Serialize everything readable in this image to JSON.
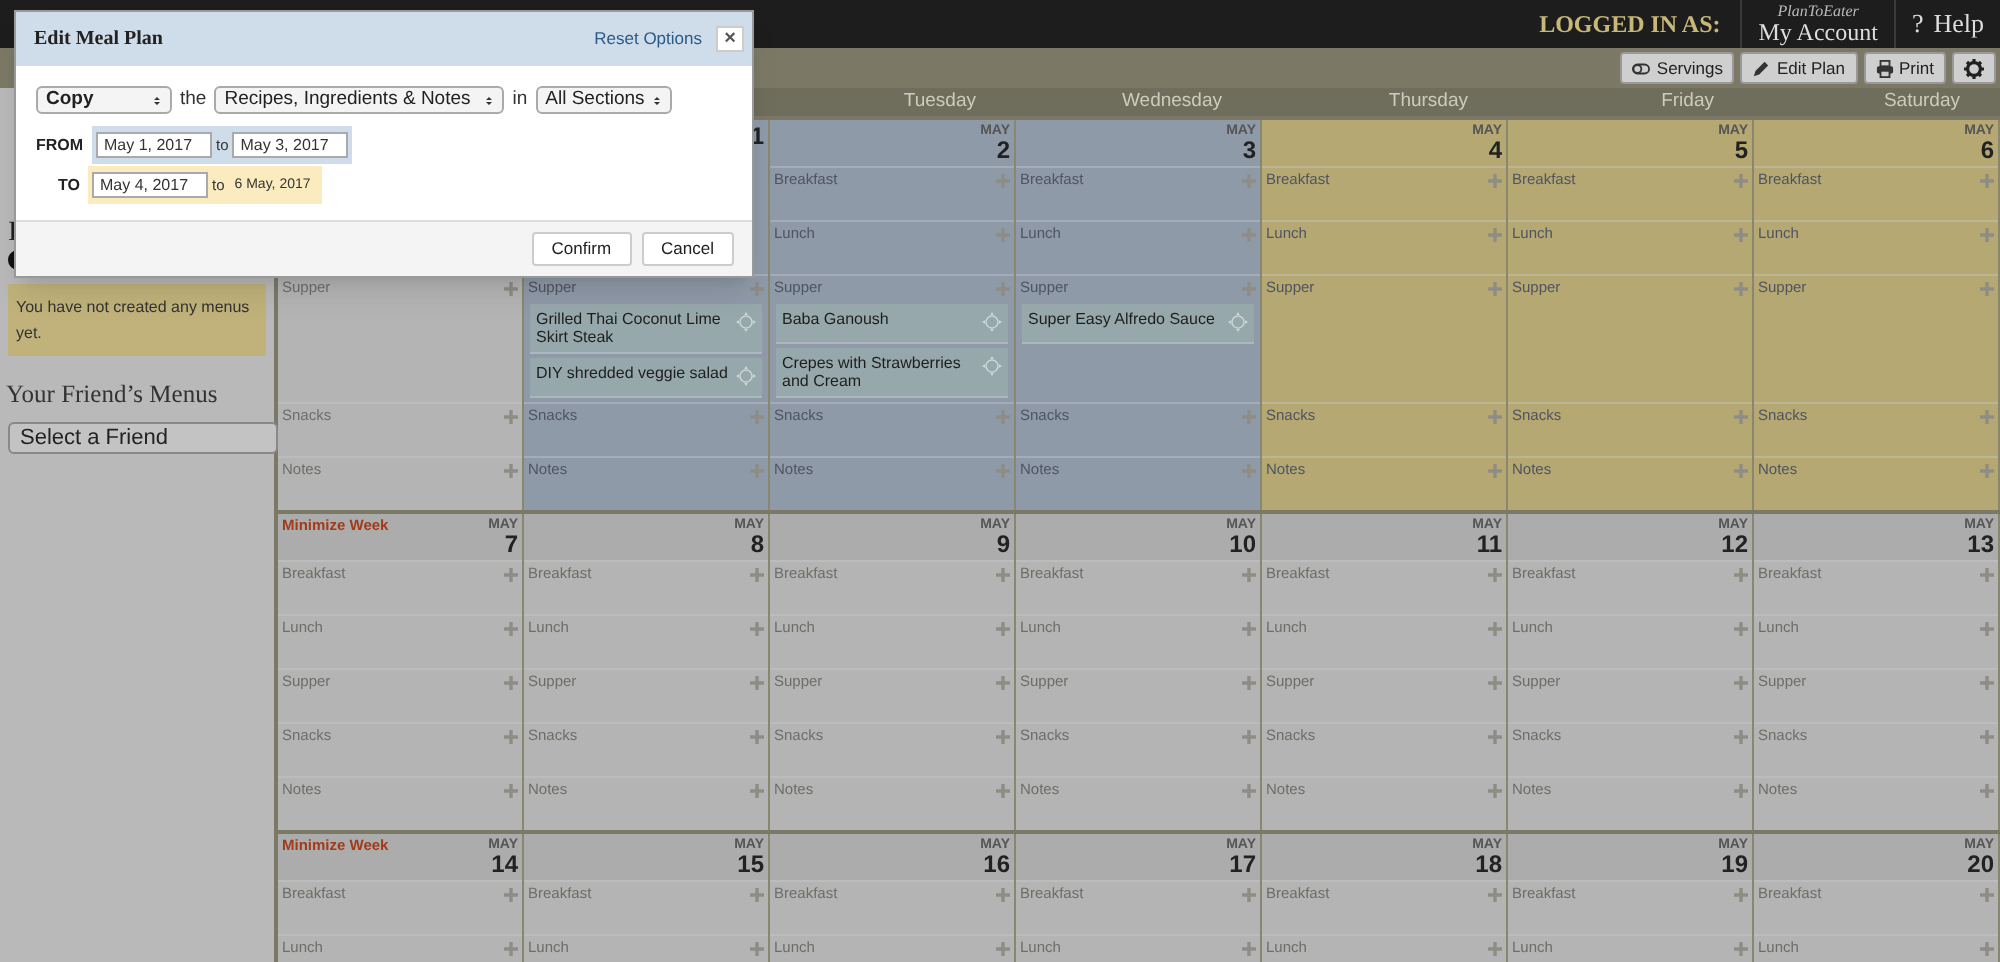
{
  "header": {
    "logged_in_label": "LOGGED IN AS:",
    "account_brand": "PlanToEater",
    "account_link": "My Account",
    "help_icon": "?",
    "help": "Help"
  },
  "toolbar": {
    "buttons": [
      {
        "kind": "servings",
        "label": "Servings"
      },
      {
        "kind": "edit",
        "label": "Edit Plan"
      },
      {
        "kind": "print",
        "label": "Print"
      },
      {
        "kind": "settings"
      }
    ]
  },
  "sidebar": {
    "partial_heading": "I",
    "notice": "You have not created any menus yet.",
    "friends_heading": "Your Friend’s Menus",
    "friend_select": "Select a Friend"
  },
  "day_names": [
    "Tuesday",
    "Wednesday",
    "Thursday",
    "Friday",
    "Saturday"
  ],
  "weeks": [
    {
      "days": [
        {
          "from_range": false,
          "to_range": false,
          "slots": [
            {
              "label": "Supper"
            },
            {
              "label": "Snacks"
            },
            {
              "label": "Notes"
            }
          ]
        },
        {
          "from_range": true,
          "to_range": false,
          "day": "1",
          "slots": [
            {
              "label": "Supper",
              "items": [
                {
                  "title": "Grilled Thai Coconut Lime Skirt Steak"
                },
                {
                  "title": "DIY shredded veggie salad"
                }
              ]
            },
            {
              "label": "Snacks"
            },
            {
              "label": "Notes"
            }
          ]
        },
        {
          "from_range": true,
          "to_range": false,
          "month": "MAY",
          "day": "2",
          "slots": [
            {
              "label": "Breakfast"
            },
            {
              "label": "Lunch"
            },
            {
              "label": "Supper",
              "items": [
                {
                  "title": "Baba Ganoush"
                },
                {
                  "title": "Crepes with Strawberries and Cream"
                }
              ]
            },
            {
              "label": "Snacks"
            },
            {
              "label": "Notes"
            }
          ]
        },
        {
          "from_range": true,
          "to_range": false,
          "month": "MAY",
          "day": "3",
          "slots": [
            {
              "label": "Breakfast"
            },
            {
              "label": "Lunch"
            },
            {
              "label": "Supper",
              "items": [
                {
                  "title": "Super Easy Alfredo Sauce"
                }
              ]
            },
            {
              "label": "Snacks"
            },
            {
              "label": "Notes"
            }
          ]
        },
        {
          "from_range": false,
          "to_range": true,
          "month": "MAY",
          "day": "4",
          "slots": [
            {
              "label": "Breakfast"
            },
            {
              "label": "Lunch"
            },
            {
              "label": "Supper"
            },
            {
              "label": "Snacks"
            },
            {
              "label": "Notes"
            }
          ]
        },
        {
          "from_range": false,
          "to_range": true,
          "month": "MAY",
          "day": "5",
          "slots": [
            {
              "label": "Breakfast"
            },
            {
              "label": "Lunch"
            },
            {
              "label": "Supper"
            },
            {
              "label": "Snacks"
            },
            {
              "label": "Notes"
            }
          ]
        },
        {
          "from_range": false,
          "to_range": true,
          "month": "MAY",
          "day": "6",
          "slots": [
            {
              "label": "Breakfast"
            },
            {
              "label": "Lunch"
            },
            {
              "label": "Supper"
            },
            {
              "label": "Snacks"
            },
            {
              "label": "Notes"
            }
          ]
        }
      ]
    },
    {
      "minimize": "Minimize Week",
      "days": [
        {
          "from_range": false,
          "to_range": false,
          "month": "MAY",
          "day": "7",
          "slots": [
            {
              "label": "Breakfast"
            },
            {
              "label": "Lunch"
            },
            {
              "label": "Supper"
            },
            {
              "label": "Snacks"
            },
            {
              "label": "Notes"
            }
          ]
        },
        {
          "from_range": false,
          "to_range": false,
          "month": "MAY",
          "day": "8",
          "slots": [
            {
              "label": "Breakfast"
            },
            {
              "label": "Lunch"
            },
            {
              "label": "Supper"
            },
            {
              "label": "Snacks"
            },
            {
              "label": "Notes"
            }
          ]
        },
        {
          "from_range": false,
          "to_range": false,
          "month": "MAY",
          "day": "9",
          "slots": [
            {
              "label": "Breakfast"
            },
            {
              "label": "Lunch"
            },
            {
              "label": "Supper"
            },
            {
              "label": "Snacks"
            },
            {
              "label": "Notes"
            }
          ]
        },
        {
          "from_range": false,
          "to_range": false,
          "month": "MAY",
          "day": "10",
          "slots": [
            {
              "label": "Breakfast"
            },
            {
              "label": "Lunch"
            },
            {
              "label": "Supper"
            },
            {
              "label": "Snacks"
            },
            {
              "label": "Notes"
            }
          ]
        },
        {
          "from_range": false,
          "to_range": false,
          "month": "MAY",
          "day": "11",
          "slots": [
            {
              "label": "Breakfast"
            },
            {
              "label": "Lunch"
            },
            {
              "label": "Supper"
            },
            {
              "label": "Snacks"
            },
            {
              "label": "Notes"
            }
          ]
        },
        {
          "from_range": false,
          "to_range": false,
          "month": "MAY",
          "day": "12",
          "slots": [
            {
              "label": "Breakfast"
            },
            {
              "label": "Lunch"
            },
            {
              "label": "Supper"
            },
            {
              "label": "Snacks"
            },
            {
              "label": "Notes"
            }
          ]
        },
        {
          "from_range": false,
          "to_range": false,
          "month": "MAY",
          "day": "13",
          "slots": [
            {
              "label": "Breakfast"
            },
            {
              "label": "Lunch"
            },
            {
              "label": "Supper"
            },
            {
              "label": "Snacks"
            },
            {
              "label": "Notes"
            }
          ]
        }
      ]
    },
    {
      "minimize": "Minimize Week",
      "days": [
        {
          "from_range": false,
          "to_range": false,
          "month": "MAY",
          "day": "14",
          "slots": [
            {
              "label": "Breakfast"
            },
            {
              "label": "Lunch"
            }
          ]
        },
        {
          "from_range": false,
          "to_range": false,
          "month": "MAY",
          "day": "15",
          "slots": [
            {
              "label": "Breakfast"
            },
            {
              "label": "Lunch"
            }
          ]
        },
        {
          "from_range": false,
          "to_range": false,
          "month": "MAY",
          "day": "16",
          "slots": [
            {
              "label": "Breakfast"
            },
            {
              "label": "Lunch"
            }
          ]
        },
        {
          "from_range": false,
          "to_range": false,
          "month": "MAY",
          "day": "17",
          "slots": [
            {
              "label": "Breakfast"
            },
            {
              "label": "Lunch"
            }
          ]
        },
        {
          "from_range": false,
          "to_range": false,
          "month": "MAY",
          "day": "18",
          "slots": [
            {
              "label": "Breakfast"
            },
            {
              "label": "Lunch"
            }
          ]
        },
        {
          "from_range": false,
          "to_range": false,
          "month": "MAY",
          "day": "19",
          "slots": [
            {
              "label": "Breakfast"
            },
            {
              "label": "Lunch"
            }
          ]
        },
        {
          "from_range": false,
          "to_range": false,
          "month": "MAY",
          "day": "20",
          "slots": [
            {
              "label": "Breakfast"
            },
            {
              "label": "Lunch"
            }
          ]
        }
      ]
    }
  ],
  "dialog": {
    "title": "Edit Meal Plan",
    "reset": "Reset Options",
    "close": "×",
    "action_select": "Copy",
    "connector_1": "the",
    "what_select": "Recipes, Ingredients & Notes",
    "connector_2": "in",
    "section_select": "All Sections",
    "from_label": "FROM",
    "from_start": "May 1, 2017",
    "from_to": "to",
    "from_end": "May 3, 2017",
    "to_label": "TO",
    "to_start": "May 4, 2017",
    "to_to": "to",
    "to_end": "6 May, 2017",
    "buttons": [
      "Confirm",
      "Cancel"
    ]
  }
}
